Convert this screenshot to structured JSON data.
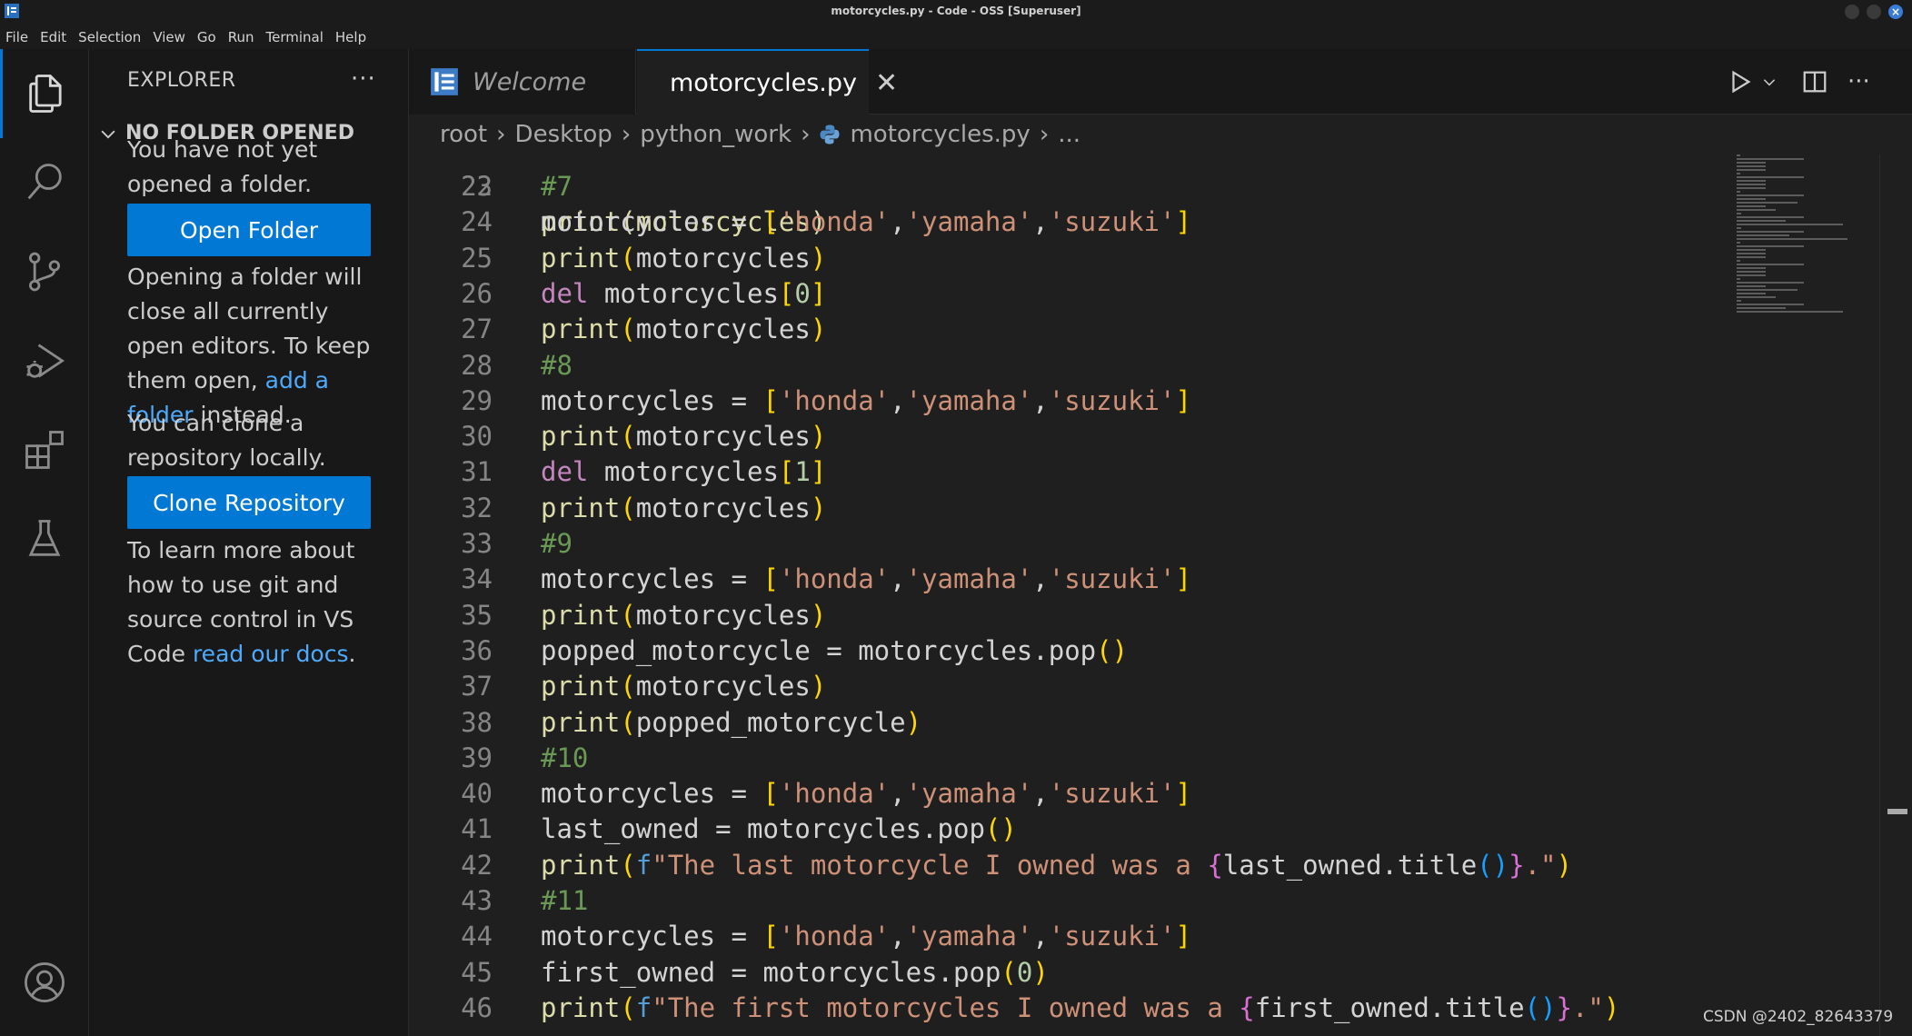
{
  "window": {
    "title": "motorcycles.py - Code - OSS [Superuser]"
  },
  "menu": [
    "File",
    "Edit",
    "Selection",
    "View",
    "Go",
    "Run",
    "Terminal",
    "Help"
  ],
  "activity_bar": {
    "items": [
      "explorer",
      "search",
      "source-control",
      "run-and-debug",
      "extensions",
      "testing",
      "accounts"
    ],
    "active": "explorer"
  },
  "sidebar": {
    "title": "EXPLORER",
    "section": "NO FOLDER OPENED",
    "para1": "You have not yet opened a folder.",
    "open_folder_label": "Open Folder",
    "para2_before": "Opening a folder will close all currently open editors. To keep them open, ",
    "para2_link": "add a folder",
    "para2_after": " instead.",
    "para3": "You can clone a repository locally.",
    "clone_label": "Clone Repository",
    "para4_before": "To learn more about how to use git and source control in VS Code ",
    "para4_link": "read our docs",
    "para4_after": "."
  },
  "tabs": [
    {
      "label": "Welcome",
      "active": false
    },
    {
      "label": "motorcycles.py",
      "active": true
    }
  ],
  "breadcrumb": [
    "root",
    "Desktop",
    "python_work",
    "motorcycles.py",
    "..."
  ],
  "editor": {
    "partial_line_number": "22",
    "partial_line_text": "print(motorcycles)",
    "lines": [
      {
        "n": "23",
        "text": "#7"
      },
      {
        "n": "24",
        "text": "motorcycles = ['honda','yamaha','suzuki']"
      },
      {
        "n": "25",
        "text": "print(motorcycles)"
      },
      {
        "n": "26",
        "text": "del motorcycles[0]"
      },
      {
        "n": "27",
        "text": "print(motorcycles)"
      },
      {
        "n": "28",
        "text": "#8"
      },
      {
        "n": "29",
        "text": "motorcycles = ['honda','yamaha','suzuki']"
      },
      {
        "n": "30",
        "text": "print(motorcycles)"
      },
      {
        "n": "31",
        "text": "del motorcycles[1]"
      },
      {
        "n": "32",
        "text": "print(motorcycles)"
      },
      {
        "n": "33",
        "text": "#9"
      },
      {
        "n": "34",
        "text": "motorcycles = ['honda','yamaha','suzuki']"
      },
      {
        "n": "35",
        "text": "print(motorcycles)"
      },
      {
        "n": "36",
        "text": "popped_motorcycle = motorcycles.pop()"
      },
      {
        "n": "37",
        "text": "print(motorcycles)"
      },
      {
        "n": "38",
        "text": "print(popped_motorcycle)"
      },
      {
        "n": "39",
        "text": "#10"
      },
      {
        "n": "40",
        "text": "motorcycles = ['honda','yamaha','suzuki']"
      },
      {
        "n": "41",
        "text": "last_owned = motorcycles.pop()"
      },
      {
        "n": "42",
        "text": "print(f\"The last motorcycle I owned was a {last_owned.title()}.\")"
      },
      {
        "n": "43",
        "text": "#11"
      },
      {
        "n": "44",
        "text": "motorcycles = ['honda','yamaha','suzuki']"
      },
      {
        "n": "45",
        "text": "first_owned = motorcycles.pop(0)"
      },
      {
        "n": "46",
        "text": "print(f\"The first motorcycles I owned was a {first_owned.title()}.\")"
      }
    ]
  },
  "watermark": "CSDN @2402_82643379",
  "colors": {
    "accent": "#0078d4",
    "editor_bg": "#1f1f1f",
    "sidebar_bg": "#181818",
    "link": "#4daafc"
  }
}
